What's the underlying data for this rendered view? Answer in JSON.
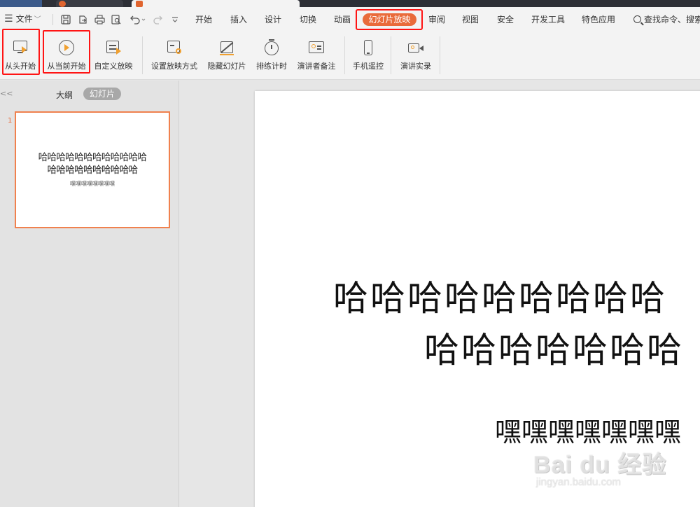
{
  "window": {
    "tabs": [
      {
        "label": ""
      },
      {
        "label": ""
      }
    ]
  },
  "menubar": {
    "file_label": "文件",
    "tabs": [
      {
        "label": "开始"
      },
      {
        "label": "插入"
      },
      {
        "label": "设计"
      },
      {
        "label": "切换"
      },
      {
        "label": "动画"
      },
      {
        "label": "幻灯片放映"
      },
      {
        "label": "审阅"
      },
      {
        "label": "视图"
      },
      {
        "label": "安全"
      },
      {
        "label": "开发工具"
      },
      {
        "label": "特色应用"
      }
    ],
    "active_tab": "幻灯片放映",
    "search_label": "查找命令、搜索",
    "quick_access_icons": [
      "save-icon",
      "export-icon",
      "print-icon",
      "print-preview-icon",
      "undo-icon",
      "redo-icon",
      "customize-icon"
    ]
  },
  "ribbon": {
    "buttons": [
      {
        "label": "从头开始",
        "icon": "monitor-play-icon"
      },
      {
        "label": "从当前开始",
        "icon": "circle-play-icon"
      },
      {
        "label": "自定义放映",
        "icon": "custom-show-icon"
      },
      {
        "label": "设置放映方式",
        "icon": "setup-show-icon"
      },
      {
        "label": "隐藏幻灯片",
        "icon": "hide-slide-icon"
      },
      {
        "label": "排练计时",
        "icon": "stopwatch-icon"
      },
      {
        "label": "演讲者备注",
        "icon": "speaker-notes-icon"
      },
      {
        "label": "手机遥控",
        "icon": "phone-icon"
      },
      {
        "label": "演讲实录",
        "icon": "camera-icon"
      }
    ]
  },
  "left_panel": {
    "outline_tab": "大纲",
    "slides_tab": "幻灯片",
    "collapse_glyph": "<<",
    "slides": [
      {
        "number": "1",
        "title_line1": "哈哈哈哈哈哈哈哈哈哈哈哈",
        "title_line2": "哈哈哈哈哈哈哈哈哈哈",
        "subtitle": "嘿嘿嘿嘿嘿嘿嘿嘿"
      }
    ]
  },
  "slide": {
    "title_line1": "哈哈哈哈哈哈哈哈哈",
    "title_line2": "哈哈哈哈哈哈哈",
    "subtitle": "嘿嘿嘿嘿嘿嘿嘿"
  },
  "watermark": {
    "brand": "Bai du 经验",
    "url": "jingyan.baidu.com"
  },
  "colors": {
    "accent": "#e96b3b",
    "highlight_box": "#ff1414",
    "thumb_border": "#f0814e",
    "icon_accent": "#f0a030"
  }
}
